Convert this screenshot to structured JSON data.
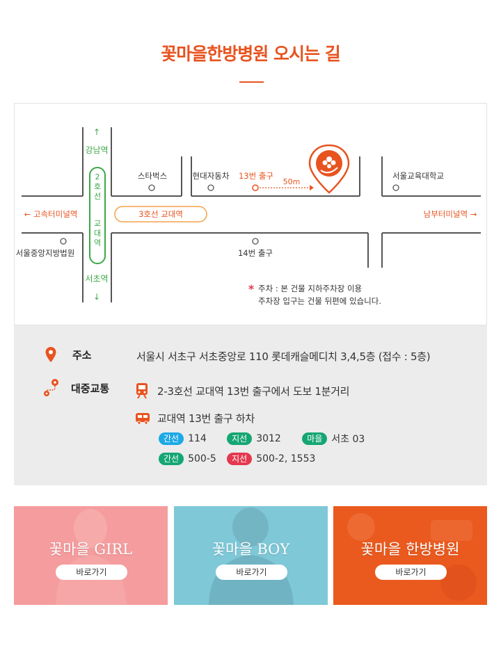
{
  "page": {
    "title": "꽃마을한방병원 오시는 길"
  },
  "map": {
    "gangnam": "강남역",
    "seocho": "서초역",
    "line2": "2호선",
    "line2_station": "교대역",
    "starbucks": "스타벅스",
    "hyundai": "현대자동차",
    "exit13": "13번 출구",
    "distance": "50m",
    "seoul_edu_univ": "서울교육대학교",
    "express_terminal": "← 고속터미널역",
    "line3_station": "3호선 교대역",
    "nambu_terminal": "남부터미널역 →",
    "district_court": "서울중앙지방법원",
    "exit14": "14번 출구",
    "parking_mark": "*",
    "parking_note1": "주차 : 본 건물 지하주차장 이용",
    "parking_note2": "주차장 입구는 건물 뒤편에 있습니다.",
    "arrow_up": "↑",
    "arrow_down": "↓",
    "colors": {
      "accent": "#e8531f",
      "green": "#3aa845",
      "road": "#555555"
    }
  },
  "info": {
    "address_label": "주소",
    "address_value": "서울시 서초구 서초중앙로 110 롯데캐슬메디치 3,4,5층 (접수 : 5층)",
    "transit_label": "대중교통",
    "subway_text": "2-3호선 교대역 13번 출구에서 도보 1분거리",
    "bus_text": "교대역 13번 출구 하차",
    "bus_routes": [
      {
        "type": "간선",
        "number": "114",
        "color": "blue"
      },
      {
        "type": "지선",
        "number": "3012",
        "color": "green"
      },
      {
        "type": "마을",
        "number": "서초 03",
        "color": "green"
      },
      {
        "type": "간선",
        "number": "500-5",
        "color": "green"
      },
      {
        "type": "지선",
        "number": "500-2, 1553",
        "color": "red"
      }
    ]
  },
  "cards": [
    {
      "title": "꽃마을 GIRL",
      "button": "바로가기",
      "bg": "#f59c9e"
    },
    {
      "title": "꽃마을 BOY",
      "button": "바로가기",
      "bg": "#7ec8d8"
    },
    {
      "title": "꽃마을 한방병원",
      "button": "바로가기",
      "bg": "#ea5a1e"
    }
  ]
}
